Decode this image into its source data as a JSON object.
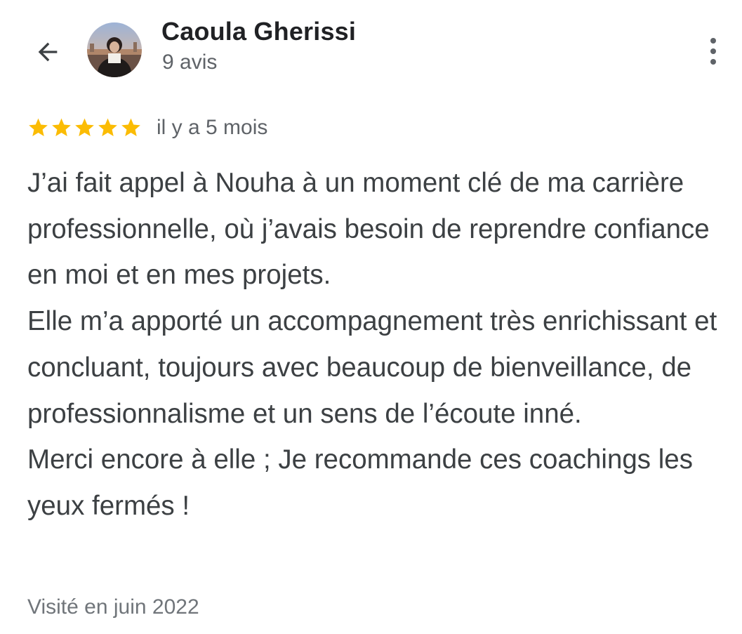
{
  "header": {
    "reviewer_name": "Caoula Gherissi",
    "review_count": "9 avis",
    "icons": {
      "back": "arrow-back-icon",
      "more": "more-vert-icon"
    }
  },
  "review": {
    "rating": 5,
    "max_rating": 5,
    "star_color": "#fbbc04",
    "date": "il y a 5 mois",
    "paragraphs": [
      "J’ai fait appel à Nouha à un moment clé de ma carrière professionnelle, où j’avais besoin de reprendre confiance en moi et en mes projets.",
      "Elle m’a apporté un accompagnement très enrichissant et concluant, toujours avec beaucoup de bienveillance, de professionnalisme et un sens de l’écoute inné.",
      "Merci encore à elle ; Je recommande ces coachings les yeux fermés !"
    ],
    "visit": "Visité en juin 2022"
  }
}
